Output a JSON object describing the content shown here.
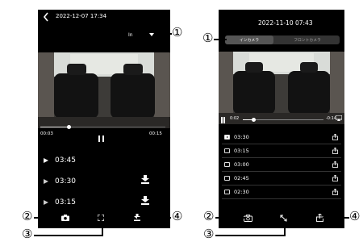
{
  "left_screen": {
    "timestamp": "2022-12-07 17:34",
    "camera_select": "In",
    "time_elapsed": "00:03",
    "time_total": "00:15",
    "progress": 0.23,
    "clips": [
      {
        "time": "03:45",
        "download": false
      },
      {
        "time": "03:30",
        "download": true
      },
      {
        "time": "03:15",
        "download": true
      }
    ]
  },
  "right_screen": {
    "timestamp": "2022-11-10 07:43",
    "tabs": [
      "インカメラ",
      "フロントカメラ"
    ],
    "active_tab": 0,
    "time_elapsed": "0:02",
    "time_remaining": "-0:14",
    "progress": 0.13,
    "clips": [
      {
        "time": "03:30",
        "playing": true
      },
      {
        "time": "03:15",
        "playing": false
      },
      {
        "time": "03:00",
        "playing": false
      },
      {
        "time": "02:45",
        "playing": false
      },
      {
        "time": "02:30",
        "playing": false
      }
    ]
  },
  "callouts": [
    "①",
    "②",
    "③",
    "④"
  ],
  "colors": {
    "screen_bg": "#000000",
    "tab_bg": "#333333",
    "tab_active": "#555555",
    "text": "#ffffff"
  }
}
